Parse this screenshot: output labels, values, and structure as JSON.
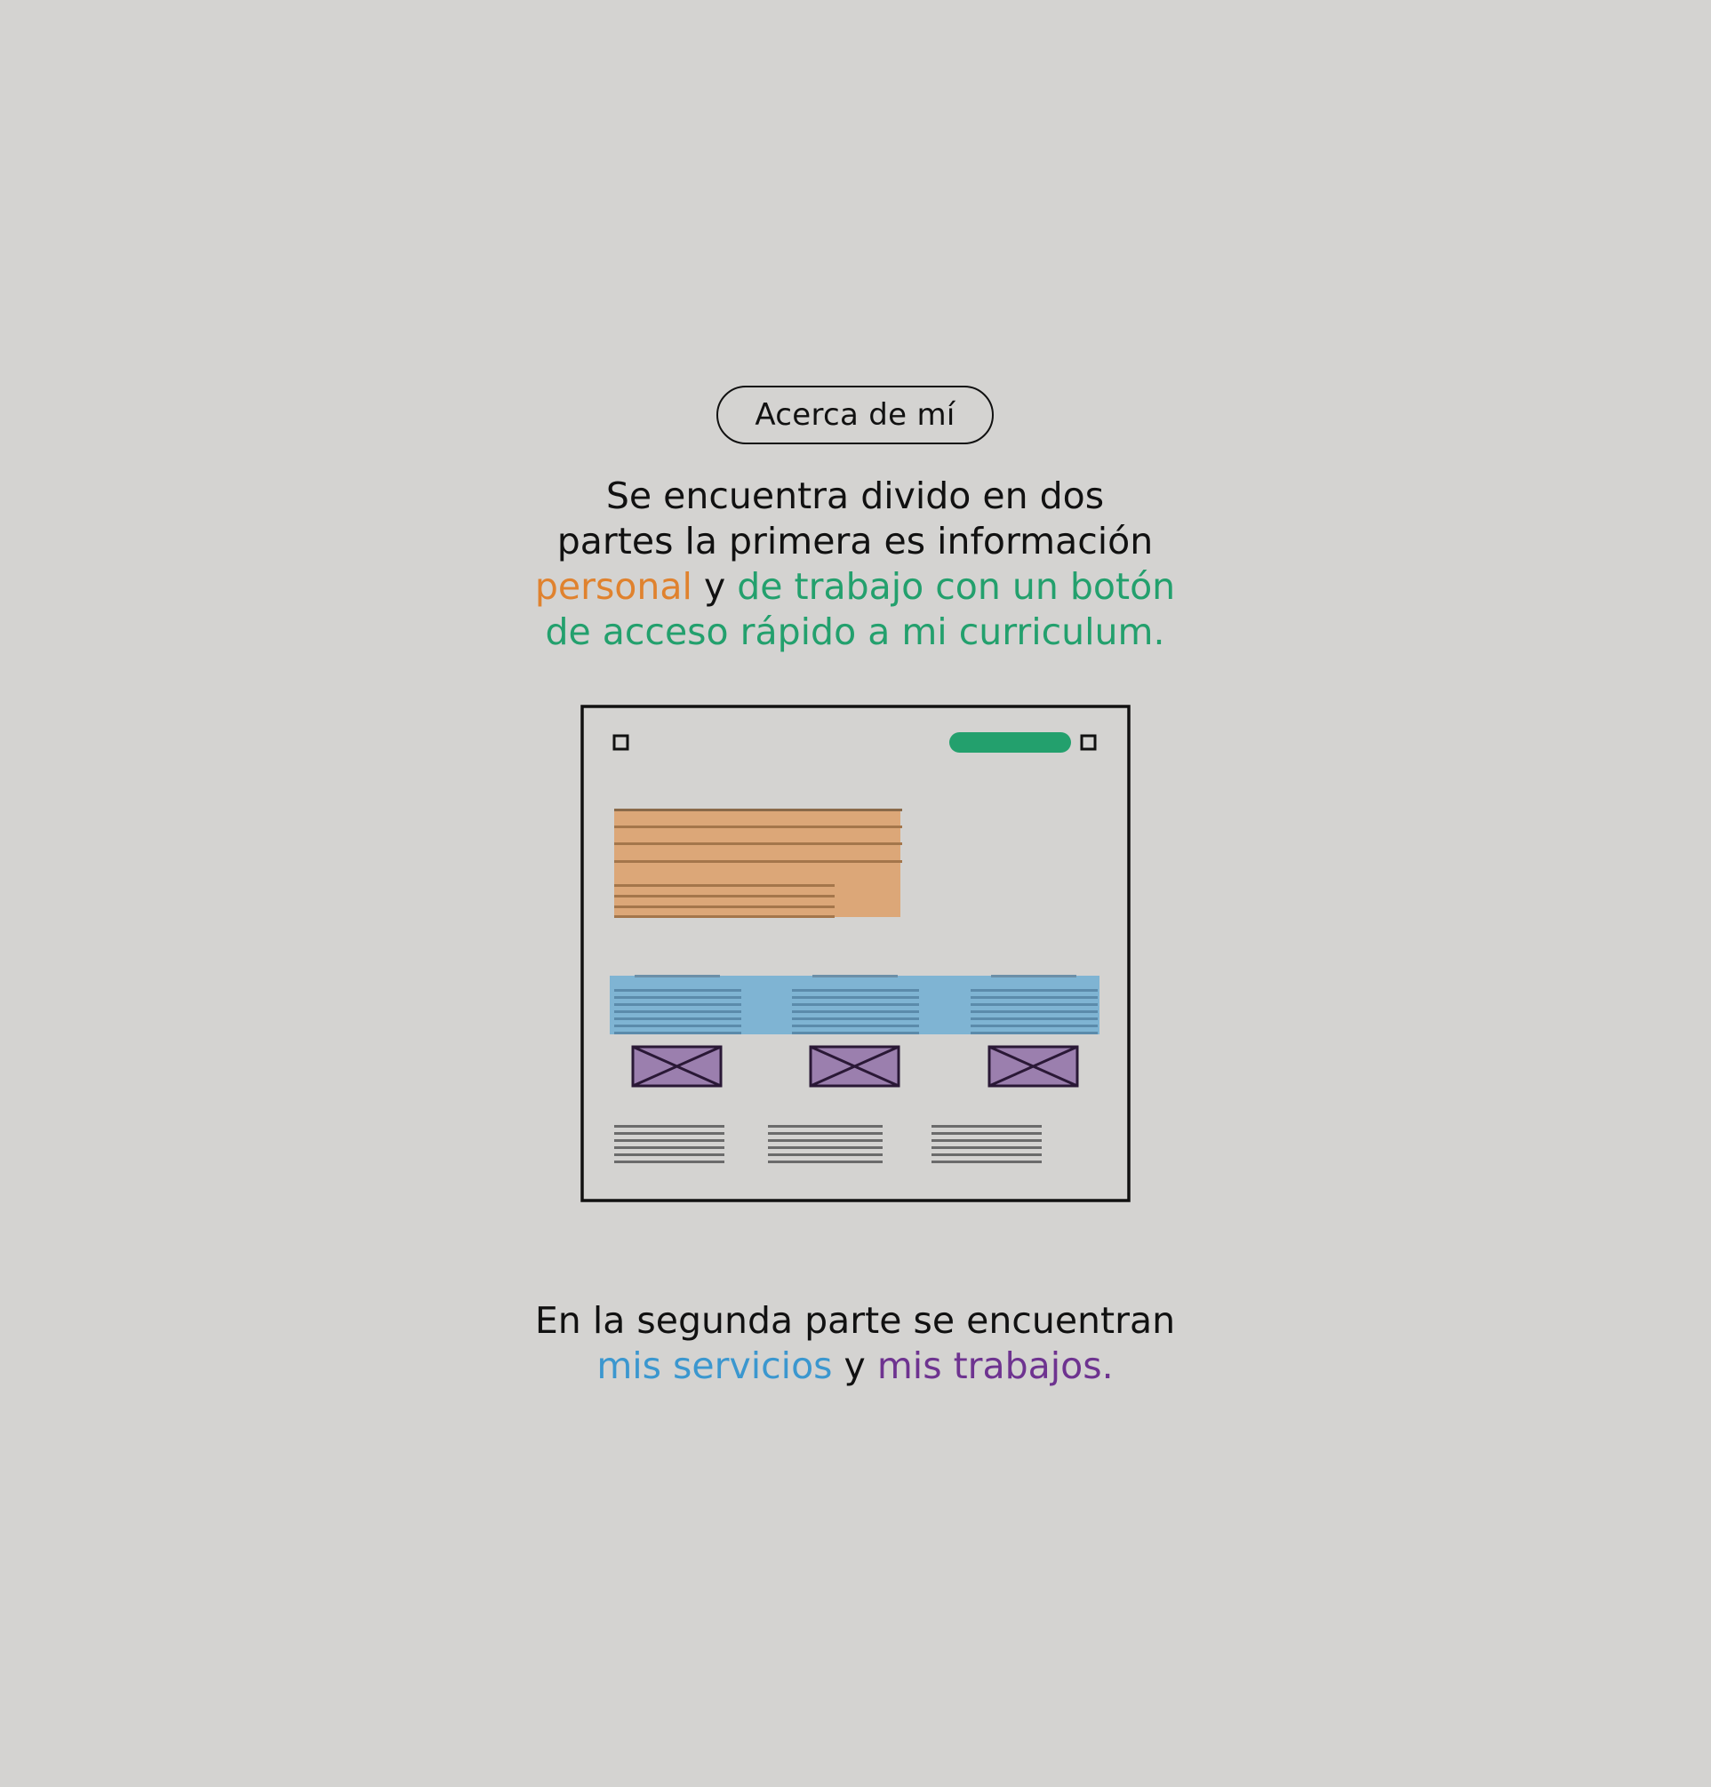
{
  "section_label": "Acerca de mí",
  "colors": {
    "background": "#d4d3d1",
    "text": "#111111",
    "personal": "#e0822e",
    "work": "#23a06d",
    "services": "#3b97cf",
    "works": "#6e3390",
    "personal_block": "#dca778",
    "services_block": "#7fb4d3",
    "works_thumb": "#9b7fae"
  },
  "intro": {
    "line1": "Se encuentra divido en dos",
    "line2": "partes la primera es información",
    "line3_personal": "personal",
    "line3_y": " y ",
    "line3_work": "de trabajo con un botón",
    "line4_work": "de acceso rápido a mi curriculum."
  },
  "outro": {
    "line1": "En la segunda parte se encuentran",
    "services": "mis servicios",
    "y": " y ",
    "works": "mis trabajos."
  },
  "wireframe": {
    "services_count": 3,
    "works_count": 3,
    "text_blocks_count": 3,
    "icons": [
      "menu-square-icon",
      "cv-button",
      "menu-square-icon"
    ]
  }
}
